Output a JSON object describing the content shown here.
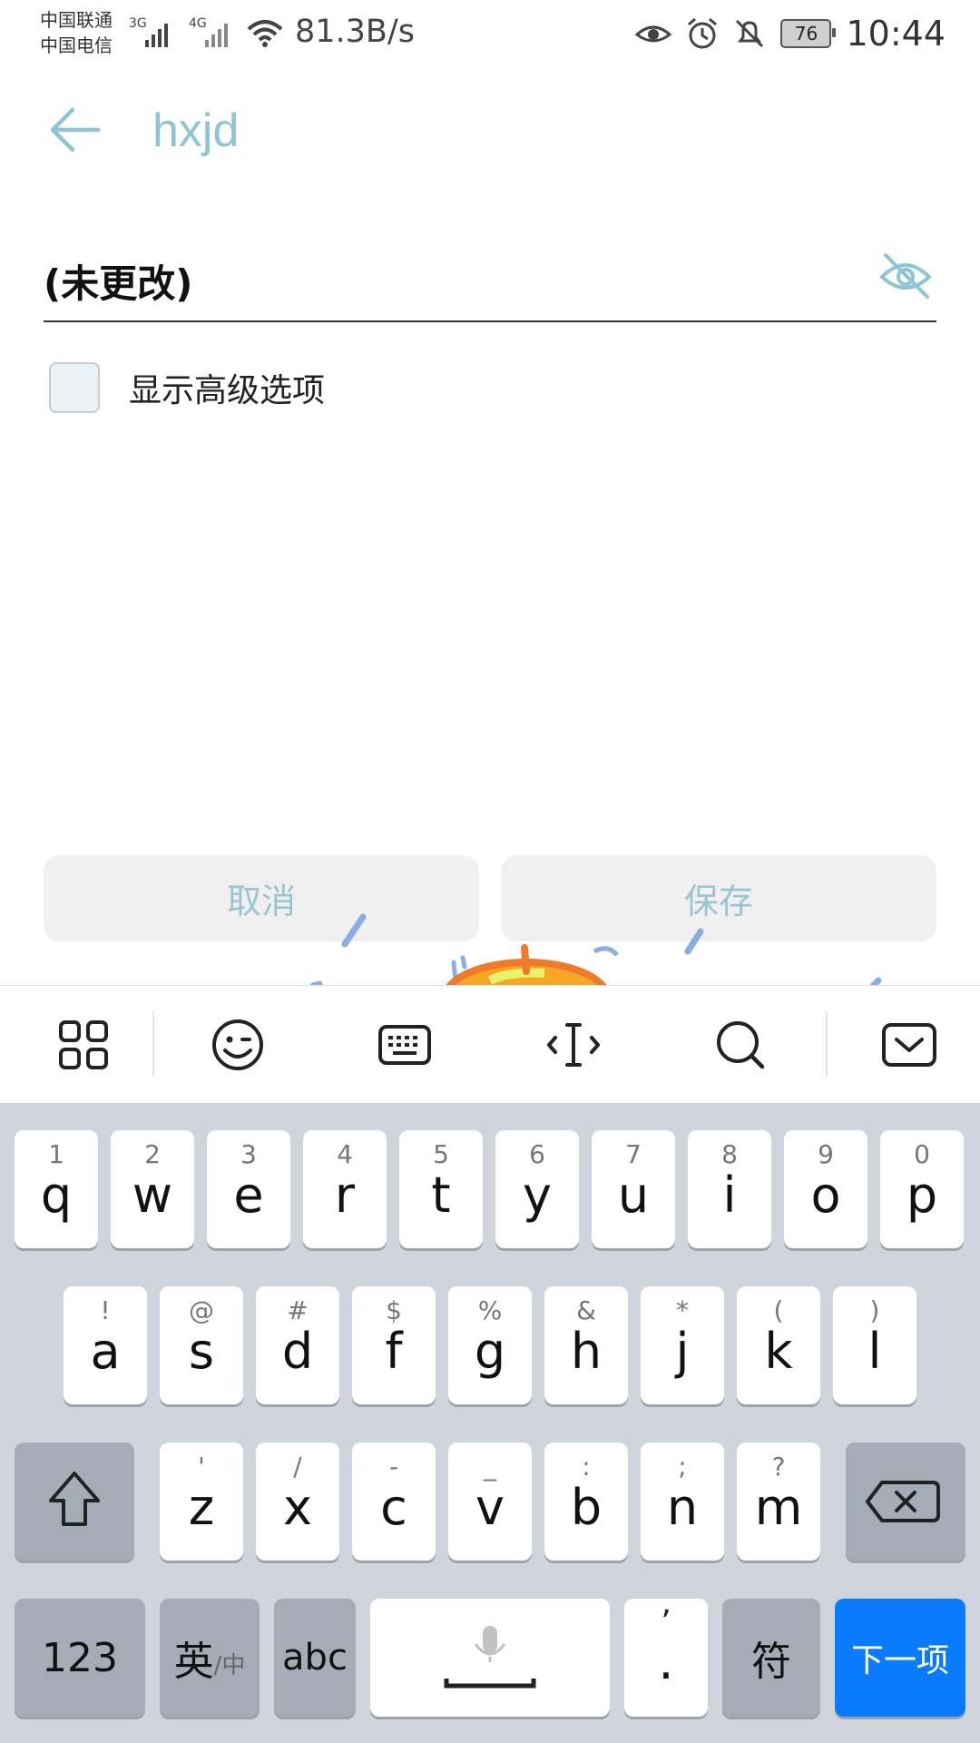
{
  "status_bar": {
    "carrier1": "中国联通",
    "carrier2": "中国电信",
    "net1": "3G",
    "net2": "4G",
    "speed": "81.3B/s",
    "battery": "76",
    "time": "10:44",
    "icons": [
      "eye-care-icon",
      "alarm-icon",
      "bell-off-icon"
    ]
  },
  "appbar": {
    "title": "hxjd"
  },
  "password_field": {
    "value": "(未更改)"
  },
  "advanced": {
    "label": "显示高级选项",
    "checked": false
  },
  "actions": {
    "cancel": "取消",
    "save": "保存"
  },
  "keyboard": {
    "row1": [
      {
        "sub": "1",
        "main": "q"
      },
      {
        "sub": "2",
        "main": "w"
      },
      {
        "sub": "3",
        "main": "e"
      },
      {
        "sub": "4",
        "main": "r"
      },
      {
        "sub": "5",
        "main": "t"
      },
      {
        "sub": "6",
        "main": "y"
      },
      {
        "sub": "7",
        "main": "u"
      },
      {
        "sub": "8",
        "main": "i"
      },
      {
        "sub": "9",
        "main": "o"
      },
      {
        "sub": "0",
        "main": "p"
      }
    ],
    "row2": [
      {
        "sub": "!",
        "main": "a"
      },
      {
        "sub": "@",
        "main": "s"
      },
      {
        "sub": "#",
        "main": "d"
      },
      {
        "sub": "$",
        "main": "f"
      },
      {
        "sub": "%",
        "main": "g"
      },
      {
        "sub": "&",
        "main": "h"
      },
      {
        "sub": "*",
        "main": "j"
      },
      {
        "sub": "(",
        "main": "k"
      },
      {
        "sub": ")",
        "main": "l"
      }
    ],
    "row3": [
      {
        "sub": "'",
        "main": "z"
      },
      {
        "sub": "/",
        "main": "x"
      },
      {
        "sub": "-",
        "main": "c"
      },
      {
        "sub": "_",
        "main": "v"
      },
      {
        "sub": ":",
        "main": "b"
      },
      {
        "sub": ";",
        "main": "n"
      },
      {
        "sub": "?",
        "main": "m"
      }
    ],
    "num_key": "123",
    "lang_key_main": "英",
    "lang_key_sub": "/中",
    "abc_key": "abc",
    "comma_sub": "’",
    "period_main": ".",
    "symbol_key": "符",
    "next_key": "下一项"
  },
  "toolbar_icons": [
    "apps-grid-icon",
    "emoji-icon",
    "keyboard-icon",
    "cursor-icon",
    "search-icon",
    "hide-keyboard-icon"
  ]
}
